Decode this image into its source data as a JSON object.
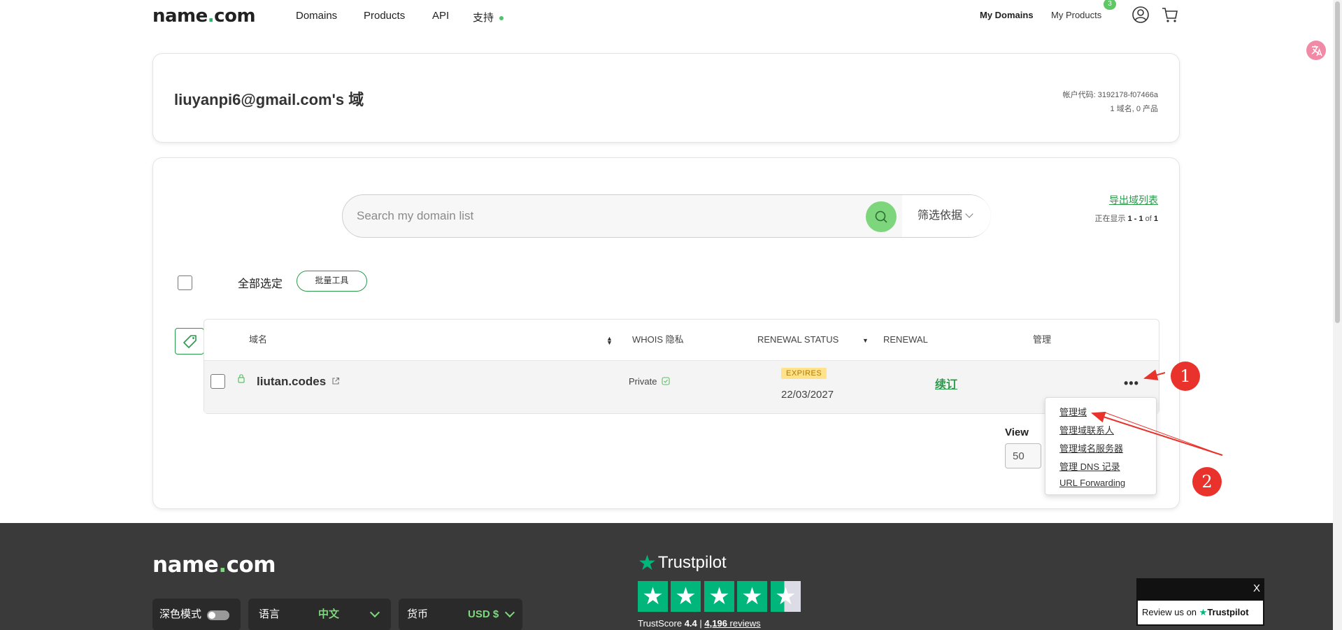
{
  "header": {
    "logo_main": "name",
    "logo_dot": ".",
    "logo_tail": "com",
    "nav": [
      "Domains",
      "Products",
      "API",
      "支持"
    ],
    "my_domains": "My Domains",
    "my_products": "My Products",
    "badge_count": "3",
    "account_icon": "user-circle-icon",
    "cart_icon": "cart-icon"
  },
  "account": {
    "title": "liuyanpi6@gmail.com's 域",
    "account_code": "帐户代码: 3192178-f07466a",
    "summary": "1 域名, 0 产品"
  },
  "search": {
    "placeholder": "Search my domain list",
    "filter_label": "筛选依据",
    "export_link": "导出域列表",
    "showing_prefix": "正在显示 ",
    "showing_range": "1 - 1",
    "showing_of": " of ",
    "showing_total": "1"
  },
  "bulk": {
    "select_all": "全部选定",
    "bulk_tools": "批量工具"
  },
  "table": {
    "headers": {
      "domain": "域名",
      "whois": "WHOIS 隐私",
      "renewal_status": "RENEWAL STATUS",
      "renewal": "RENEWAL",
      "manage": "管理"
    },
    "rows": [
      {
        "domain": "liutan.codes",
        "whois": "Private",
        "status_badge": "EXPIRES",
        "expiry_date": "22/03/2027",
        "renew_label": "续订",
        "more_label": "•••"
      }
    ]
  },
  "pagination": {
    "view_label": "View",
    "view_value": "50"
  },
  "dropdown": {
    "items": [
      "管理域",
      "管理域联系人",
      "管理域名服务器",
      "管理 DNS 记录",
      "URL Forwarding"
    ]
  },
  "annotations": {
    "marker_1": "1",
    "marker_2": "2",
    "color": "#e8322b"
  },
  "footer": {
    "logo_main": "name",
    "logo_dot": ".",
    "logo_tail": "com",
    "dark_mode": "深色模式",
    "language_label": "语言",
    "language_value": "中文",
    "currency_label": "货币",
    "currency_value": "USD $",
    "trustpilot_name": "Trustpilot",
    "trustscore_label": "TrustScore ",
    "trustscore_value": "4.4",
    "separator": " | ",
    "review_count": "4,196",
    "reviews_word": " reviews"
  },
  "review_widget": {
    "close": "X",
    "review_text": "Review us on ",
    "brand": "Trustpilot"
  },
  "colors": {
    "accent_green": "#2a9a4a",
    "search_green": "#7dd67c",
    "trustpilot_green": "#00b67a",
    "footer_bg": "#3a3a3a",
    "expires_badge": "#ffe28a"
  }
}
